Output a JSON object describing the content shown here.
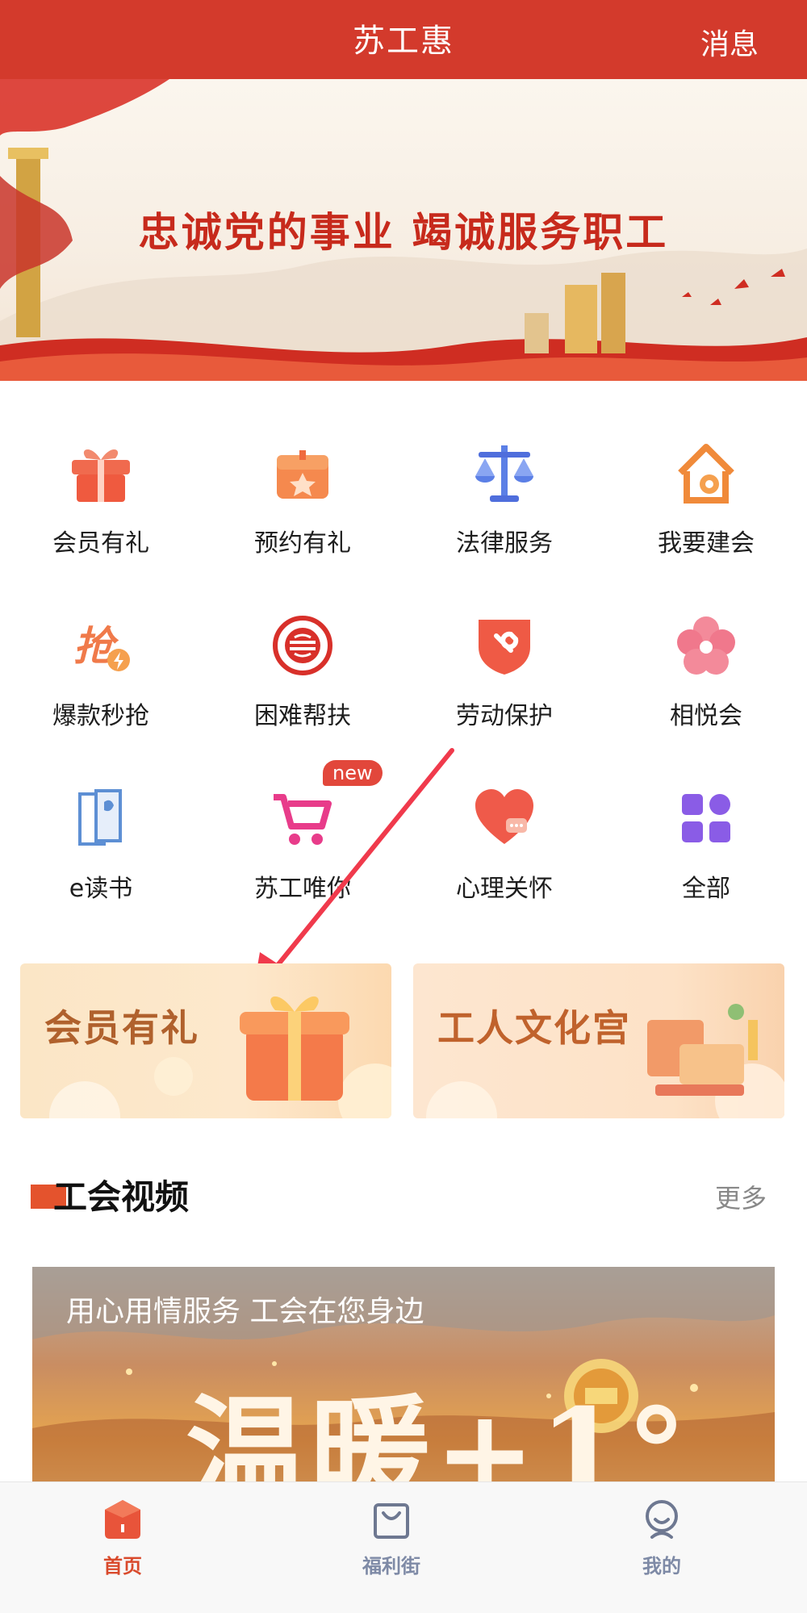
{
  "header": {
    "title": "苏工惠",
    "message": "消息"
  },
  "banner": {
    "slogan": "忠诚党的事业  竭诚服务职工"
  },
  "grid": {
    "items": [
      {
        "label": "会员有礼",
        "icon": "gift-icon"
      },
      {
        "label": "预约有礼",
        "icon": "gift-box-icon"
      },
      {
        "label": "法律服务",
        "icon": "scales-icon"
      },
      {
        "label": "我要建会",
        "icon": "house-gear-icon"
      },
      {
        "label": "爆款秒抢",
        "icon": "flash-grab-icon"
      },
      {
        "label": "困难帮扶",
        "icon": "union-badge-icon"
      },
      {
        "label": "劳动保护",
        "icon": "shield-wrench-icon"
      },
      {
        "label": "相悦会",
        "icon": "flower-heart-icon"
      },
      {
        "label": "e读书",
        "icon": "book-icon"
      },
      {
        "label": "苏工唯你",
        "icon": "cart-icon",
        "badge": "new"
      },
      {
        "label": "心理关怀",
        "icon": "heart-chat-icon"
      },
      {
        "label": "全部",
        "icon": "grid-icon"
      }
    ]
  },
  "promos": [
    {
      "text": "会员有礼"
    },
    {
      "text": "工人文化宫"
    }
  ],
  "section": {
    "title": "工会视频",
    "more": "更多"
  },
  "video": {
    "caption": "用心用情服务 工会在您身边",
    "big_text": "温暖+1°"
  },
  "tabbar": {
    "items": [
      {
        "label": "首页",
        "icon": "home-icon",
        "active": true
      },
      {
        "label": "福利街",
        "icon": "shopping-bag-icon",
        "active": false
      },
      {
        "label": "我的",
        "icon": "profile-icon",
        "active": false
      }
    ]
  },
  "colors": {
    "brand": "#d33a2c",
    "accent": "#e4532d",
    "tab_active": "#d94a2c",
    "tab_inactive": "#7e8aa6"
  }
}
